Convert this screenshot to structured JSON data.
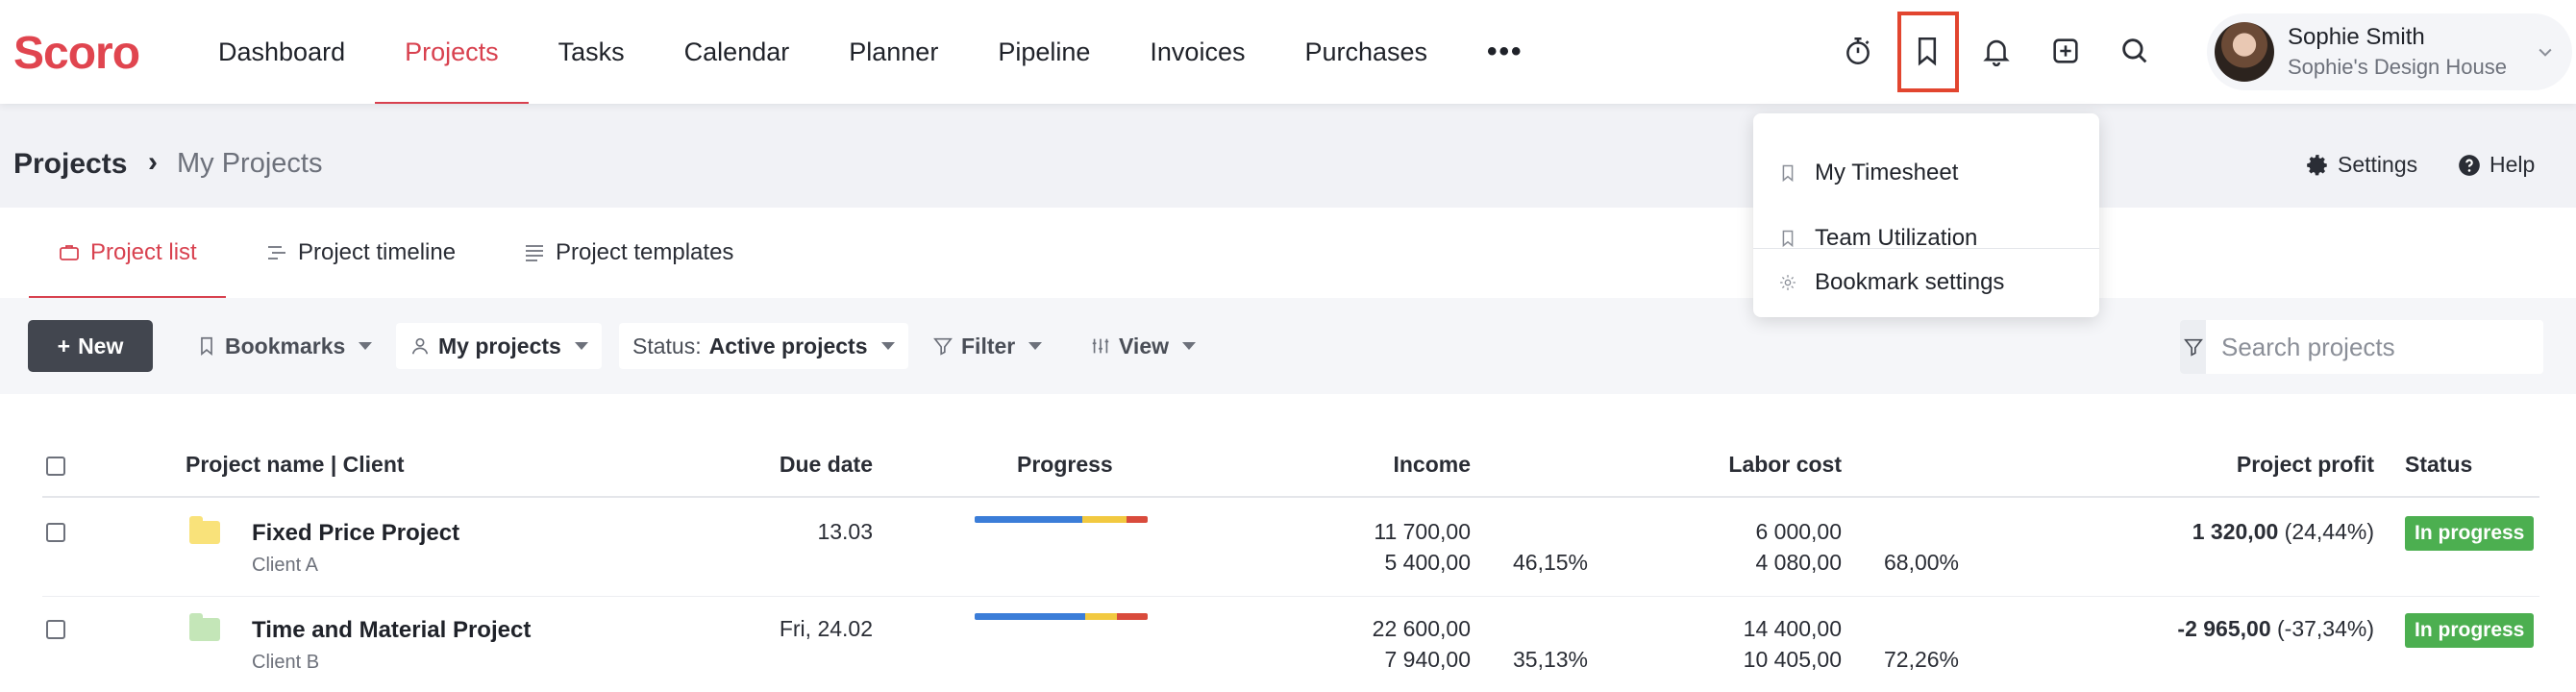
{
  "app": {
    "logo": "Scoro"
  },
  "nav": {
    "items": [
      "Dashboard",
      "Projects",
      "Tasks",
      "Calendar",
      "Planner",
      "Pipeline",
      "Invoices",
      "Purchases"
    ],
    "more": "•••",
    "active": "Projects"
  },
  "top_icons": [
    "stopwatch-icon",
    "bookmark-icon",
    "bell-icon",
    "plus-square-icon",
    "search-icon"
  ],
  "user": {
    "name": "Sophie Smith",
    "company": "Sophie's Design House"
  },
  "breadcrumb": {
    "main": "Projects",
    "separator": "›",
    "sub": "My Projects"
  },
  "header_links": {
    "settings": "Settings",
    "help": "Help"
  },
  "tabs": [
    "Project list",
    "Project timeline",
    "Project templates"
  ],
  "toolbar": {
    "new_label": "New",
    "bookmarks_label": "Bookmarks",
    "my_projects_label": "My projects",
    "status_prefix": "Status:",
    "status_value": "Active projects",
    "filter_label": "Filter",
    "view_label": "View",
    "search_placeholder": "Search projects"
  },
  "table": {
    "columns": {
      "name": "Project name | Client",
      "due": "Due date",
      "progress": "Progress",
      "income": "Income",
      "labor": "Labor cost",
      "profit": "Project profit",
      "status": "Status"
    },
    "rows": [
      {
        "name": "Fixed Price Project",
        "client": "Client A",
        "folder_color": "#f9e27a",
        "due": "13.03",
        "progress_segments": [
          0.62,
          0.26,
          0.12
        ],
        "income_top": "11 700,00",
        "income_bottom": "5 400,00",
        "income_pct": "46,15%",
        "labor_top": "6 000,00",
        "labor_bottom": "4 080,00",
        "labor_pct": "68,00%",
        "profit_value": "1 320,00",
        "profit_pct": "(24,44%)",
        "status": "In progress"
      },
      {
        "name": "Time and Material Project",
        "client": "Client B",
        "folder_color": "#c4e6b8",
        "due": "Fri, 24.02",
        "progress_segments": [
          0.64,
          0.18,
          0.18
        ],
        "income_top": "22 600,00",
        "income_bottom": "7 940,00",
        "income_pct": "35,13%",
        "labor_top": "14 400,00",
        "labor_bottom": "10 405,00",
        "labor_pct": "72,26%",
        "profit_value": "-2 965,00",
        "profit_pct": "(-37,34%)",
        "status": "In progress"
      }
    ]
  },
  "bookmark_dropdown": {
    "items": [
      "My Timesheet",
      "Team Utilization"
    ],
    "settings_label": "Bookmark settings"
  },
  "colors": {
    "accent": "#d8414f",
    "highlight_border": "#e2452f",
    "status_green": "#4caf50",
    "progress_blue": "#3b7dd8",
    "progress_yellow": "#f2c940",
    "progress_red": "#d94b3c"
  }
}
